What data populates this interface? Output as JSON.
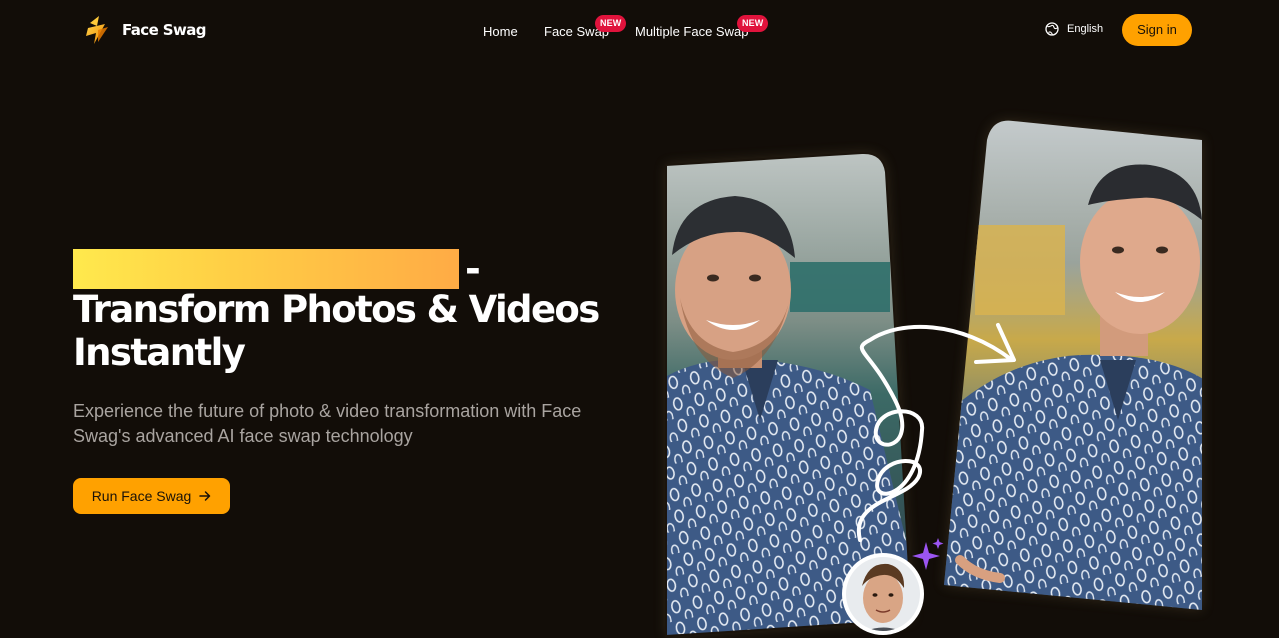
{
  "header": {
    "brand": "Face Swag",
    "nav": [
      {
        "label": "Home"
      },
      {
        "label": "Face Swap",
        "badge": "NEW"
      },
      {
        "label": "Multiple Face Swap",
        "badge": "NEW"
      }
    ],
    "language": "English",
    "signin_label": "Sign in"
  },
  "hero": {
    "dash": "-",
    "title_line1": "Transform Photos & Videos",
    "title_line2": "Instantly",
    "subtitle": "Experience the future of photo & video transformation with Face Swag's advanced AI face swap technology",
    "cta_label": "Run Face Swag"
  },
  "colors": {
    "background": "#120d08",
    "accent": "#ffa100",
    "badge": "#e0133c",
    "highlight_start": "#ffe94d",
    "highlight_end": "#ffab45",
    "subtitle_text": "#a9a4a0",
    "sparkle": "#9b55f2"
  },
  "icons": [
    "logo-bolt-icon",
    "globe-icon",
    "arrow-right-icon",
    "sparkle-icon"
  ]
}
